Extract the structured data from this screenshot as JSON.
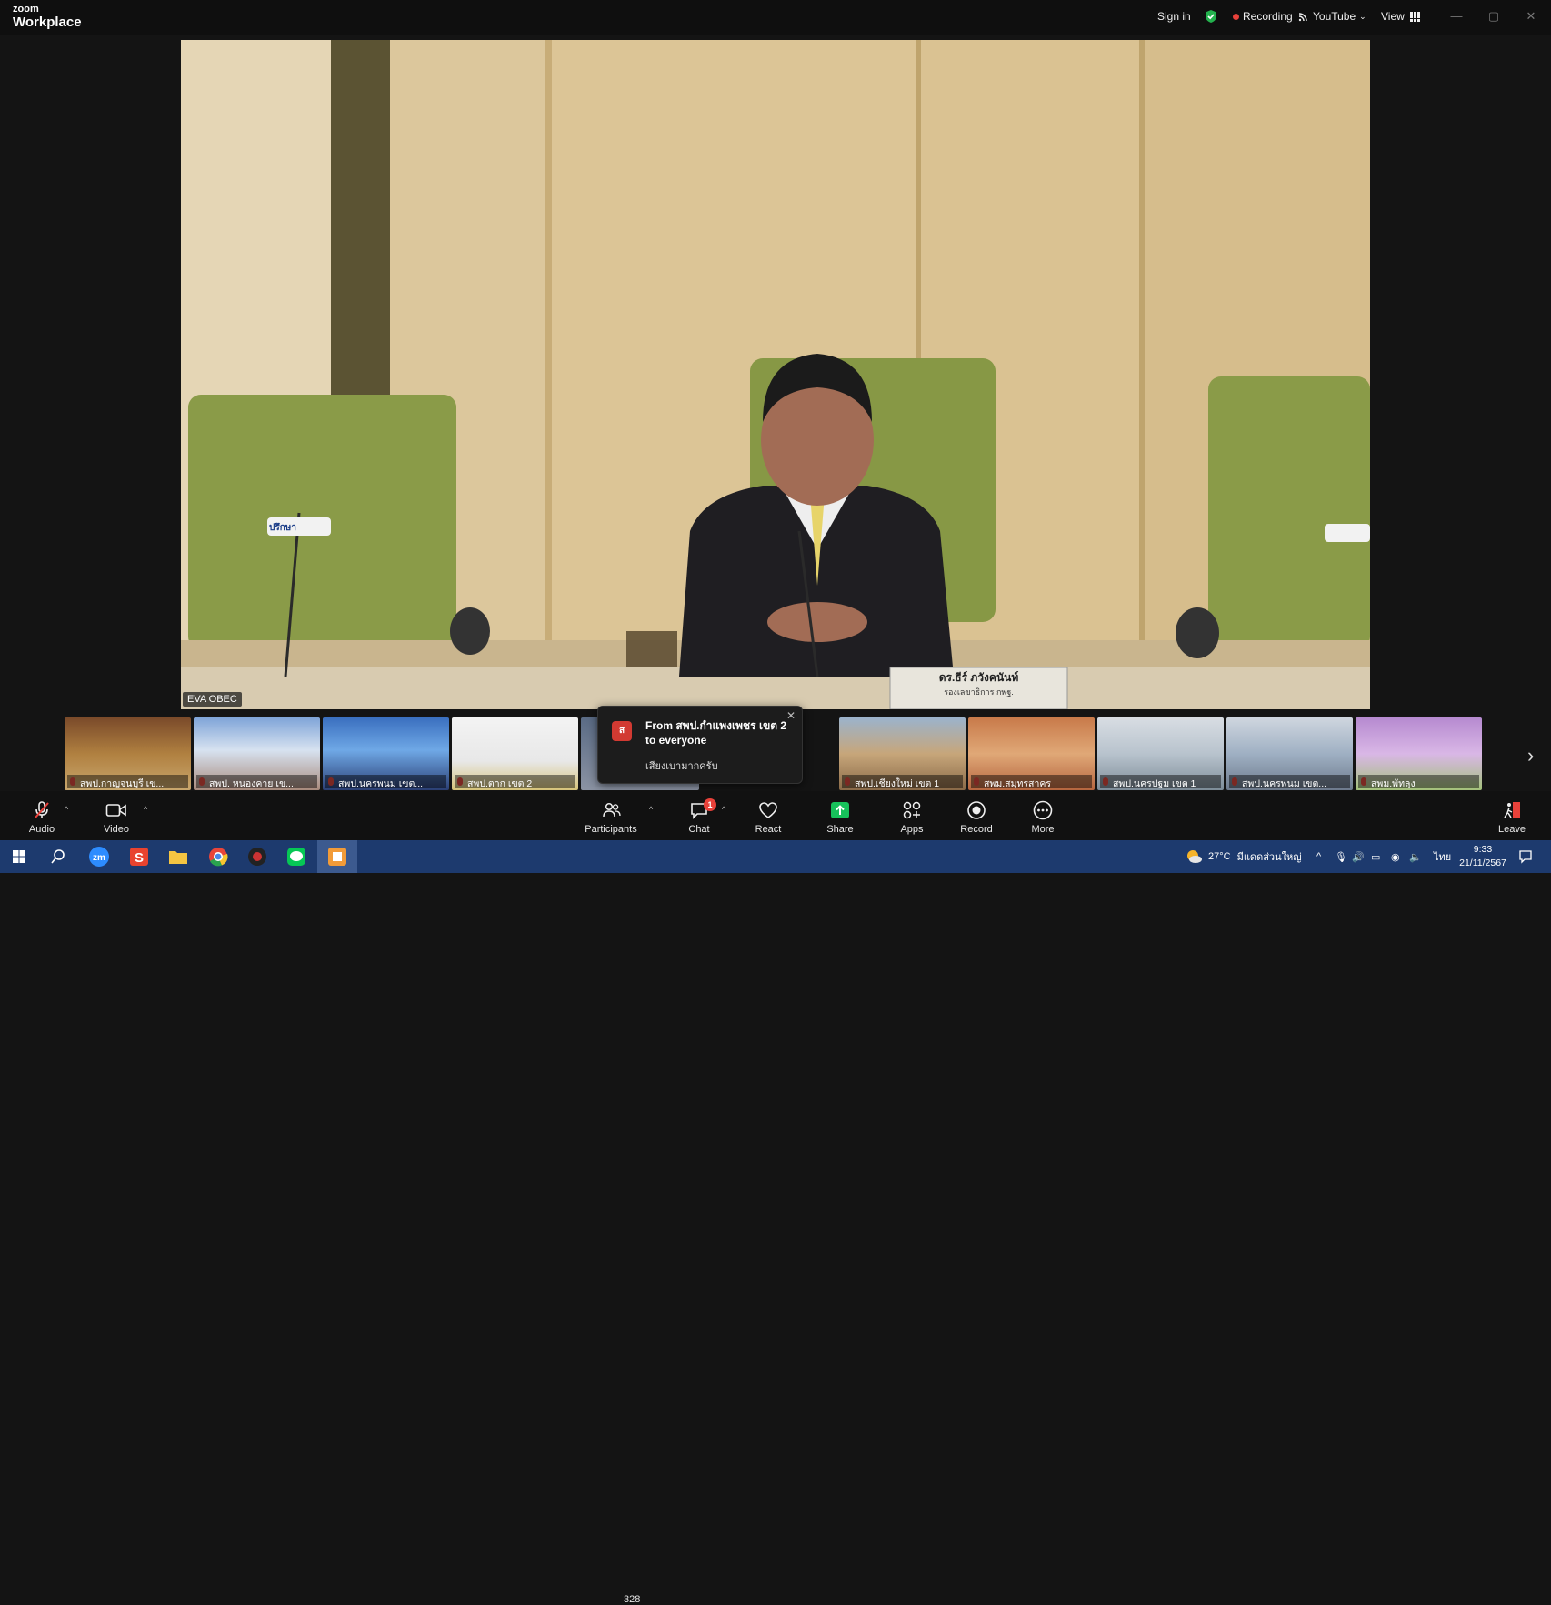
{
  "app": {
    "brand_top": "zoom",
    "brand_bottom": "Workplace"
  },
  "topbar": {
    "sign_in": "Sign in",
    "recording": "Recording",
    "youtube": "YouTube",
    "view": "View"
  },
  "main_video": {
    "speaker_label": "EVA OBEC",
    "nameplate_name": "ดร.ธีร์ ภวังคนันท์",
    "nameplate_title": "รองเลขาธิการ กพฐ.",
    "flag_text": "ปรึกษา"
  },
  "thumbnails": [
    {
      "name": "สพป.กาญจนบุรี เข..."
    },
    {
      "name": "สพป. หนองคาย เข..."
    },
    {
      "name": "สพป.นครพนม เขต..."
    },
    {
      "name": "สพป.ตาก เขต 2"
    },
    {
      "name": "สพป.เชียงใหม่ เขต 1"
    },
    {
      "name": "สพม.สมุทรสาคร"
    },
    {
      "name": "สพป.นครปฐม เขต 1"
    },
    {
      "name": "สพป.นครพนม เขต..."
    },
    {
      "name": "สพม.พัทลุง"
    }
  ],
  "chat_toast": {
    "from": "From สพป.กำแพงเพชร เขต 2 to everyone",
    "message": "เสียงเบามากครับ",
    "avatar_letter": "ส"
  },
  "toolbar": {
    "audio": "Audio",
    "video": "Video",
    "participants": "Participants",
    "participants_count": "328",
    "chat": "Chat",
    "chat_badge": "1",
    "react": "React",
    "share": "Share",
    "apps": "Apps",
    "record": "Record",
    "more": "More",
    "leave": "Leave"
  },
  "taskbar": {
    "temperature": "27°C",
    "weather": "มีแดดส่วนใหญ่",
    "language": "ไทย",
    "time": "9:33",
    "date": "21/11/2567"
  },
  "colors": {
    "share_green": "#17c25b",
    "record_red": "#e8413a",
    "taskbar_blue": "#1d3a6e"
  }
}
